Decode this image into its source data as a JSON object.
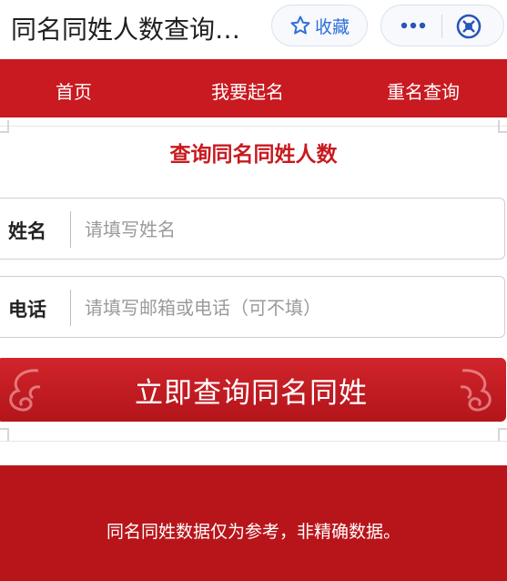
{
  "header": {
    "title": "同名同姓人数查询…",
    "favorite_label": "收藏",
    "more_icon": "more-dots-icon",
    "close_icon": "close-target-icon"
  },
  "nav": {
    "items": [
      {
        "label": "首页"
      },
      {
        "label": "我要起名"
      },
      {
        "label": "重名查询"
      }
    ]
  },
  "main": {
    "heading": "查询同名同姓人数",
    "name_field": {
      "label": "姓名",
      "placeholder": "请填写姓名",
      "value": ""
    },
    "phone_field": {
      "label": "电话",
      "placeholder": "请填写邮箱或电话（可不填）",
      "value": ""
    },
    "submit_label": "立即查询同名同姓"
  },
  "footer": {
    "text": "同名同姓数据仅为参考，非精确数据。"
  },
  "colors": {
    "brand_red": "#c81a20",
    "footer_red": "#b8151b",
    "accent_blue": "#2f6fdc"
  }
}
